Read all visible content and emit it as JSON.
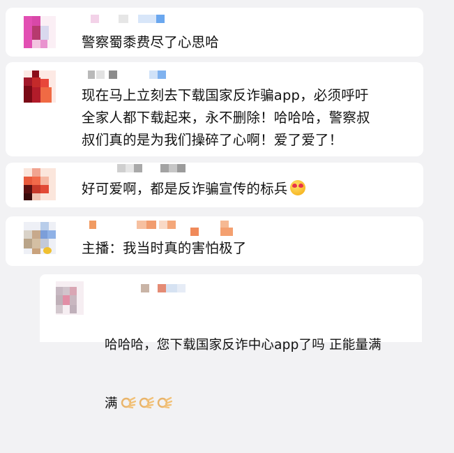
{
  "comments": [
    {
      "text": "警察蜀黍费尽了心思哈"
    },
    {
      "text": "现在马上立刻去下载国家反诈骗app，必须呼吁\n全家人都下载起来，永不删除！哈哈哈，警察叔\n叔们真的是为我们操碎了心啊！爱了爱了！"
    },
    {
      "text": "好可爱啊，都是反诈骗宣传的标兵",
      "emoji": "face-with-hearts-emoji"
    },
    {
      "text": "主播：我当时真的害怕极了"
    }
  ],
  "reply": {
    "text_line1": "哈哈哈，您下载国家反诈中心app了吗 正能量满",
    "text_line2": "满",
    "emoji": "ok-hand-emoji"
  },
  "colors": {
    "page_bg": "#f2f2f4",
    "card_bg": "#ffffff",
    "text": "#111111"
  }
}
